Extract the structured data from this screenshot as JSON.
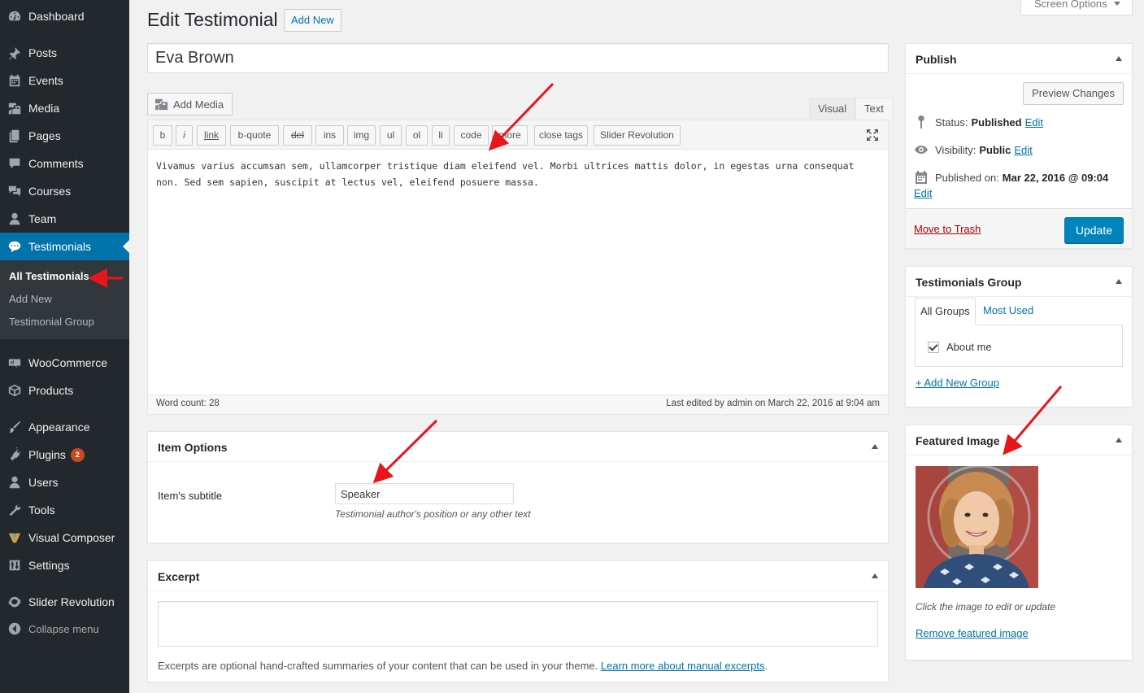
{
  "sidebar": {
    "items": [
      {
        "label": "Dashboard",
        "icon": "dashboard-icon"
      },
      {
        "label": "Posts",
        "icon": "pin-icon"
      },
      {
        "label": "Events",
        "icon": "calendar-icon"
      },
      {
        "label": "Media",
        "icon": "media-icon"
      },
      {
        "label": "Pages",
        "icon": "pages-icon"
      },
      {
        "label": "Comments",
        "icon": "comment-icon"
      },
      {
        "label": "Courses",
        "icon": "courses-icon"
      },
      {
        "label": "Team",
        "icon": "person-icon"
      },
      {
        "label": "Testimonials",
        "icon": "speech-bubble-icon"
      },
      {
        "label": "WooCommerce",
        "icon": "woocommerce-icon"
      },
      {
        "label": "Products",
        "icon": "box-icon"
      },
      {
        "label": "Appearance",
        "icon": "brush-icon"
      },
      {
        "label": "Plugins",
        "icon": "plug-icon"
      },
      {
        "label": "Users",
        "icon": "person-icon"
      },
      {
        "label": "Tools",
        "icon": "wrench-icon"
      },
      {
        "label": "Visual Composer",
        "icon": "visual-composer-icon"
      },
      {
        "label": "Settings",
        "icon": "settings-icon"
      },
      {
        "label": "Slider Revolution",
        "icon": "refresh-icon"
      }
    ],
    "submenu": [
      "All Testimonials",
      "Add New",
      "Testimonial Group"
    ],
    "plugins_badge": "2",
    "collapse_label": "Collapse menu"
  },
  "header": {
    "title": "Edit Testimonial",
    "add_new": "Add New",
    "screen_options": "Screen Options"
  },
  "post": {
    "title": "Eva Brown"
  },
  "editor": {
    "add_media": "Add Media",
    "tab_visual": "Visual",
    "tab_text": "Text",
    "quicktags": [
      "b",
      "i",
      "link",
      "b-quote",
      "del",
      "ins",
      "img",
      "ul",
      "ol",
      "li",
      "code",
      "more",
      "close tags",
      "Slider Revolution"
    ],
    "content": "Vivamus varius accumsan sem, ullamcorper tristique diam eleifend vel. Morbi ultrices mattis dolor, in egestas urna consequat non. Sed sem sapien, suscipit at lectus vel, eleifend posuere massa.",
    "word_count": "Word count: 28",
    "last_edited": "Last edited by admin on March 22, 2016 at 9:04 am"
  },
  "item_options": {
    "heading": "Item Options",
    "subtitle_label": "Item's subtitle",
    "subtitle_value": "Speaker",
    "subtitle_desc": "Testimonial author's position or any other text"
  },
  "excerpt": {
    "heading": "Excerpt",
    "desc": "Excerpts are optional hand-crafted summaries of your content that can be used in your theme.",
    "link": "Learn more about manual excerpts",
    "period": "."
  },
  "publish": {
    "heading": "Publish",
    "preview": "Preview Changes",
    "status_label": "Status:",
    "status_value": "Published",
    "visibility_label": "Visibility:",
    "visibility_value": "Public",
    "published_label": "Published on:",
    "published_value": "Mar 22, 2016 @ 09:04",
    "edit": "Edit",
    "trash": "Move to Trash",
    "update": "Update"
  },
  "testimonials_group": {
    "heading": "Testimonials Group",
    "tab_all": "All Groups",
    "tab_most": "Most Used",
    "items": [
      {
        "label": "About me",
        "checked": true
      }
    ],
    "add_new": "+ Add New Group"
  },
  "featured_image": {
    "heading": "Featured Image",
    "caption": "Click the image to edit or update",
    "remove": "Remove featured image"
  },
  "colors": {
    "sidebar_bg": "#23282d",
    "accent": "#0073aa",
    "update_button": "#0085ba",
    "trash": "#a00000",
    "annotation_arrow": "#e8161b"
  }
}
